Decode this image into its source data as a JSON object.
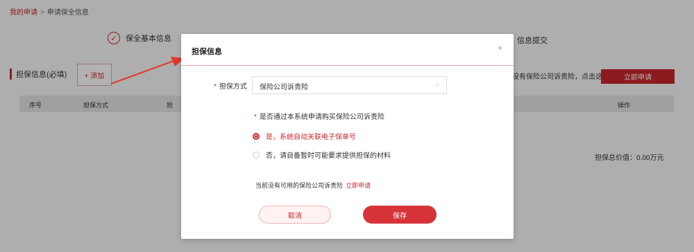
{
  "breadcrumb": {
    "home": "我的申请",
    "separator": ">",
    "current": "申请保全信息"
  },
  "steps": {
    "step1": "保全基本信息",
    "step3": "信息提交"
  },
  "section": {
    "title": "担保信息(必填)",
    "add_label": "+ 添加"
  },
  "right_tip": "没有保险公司诉责险，点击这里",
  "apply_button": "立即申请",
  "table": {
    "col_no": "序号",
    "col_method": "担保方式",
    "col_other": "担",
    "col_action": "操作"
  },
  "total": "担保总价值：0.00万元",
  "modal": {
    "title": "担保信息",
    "close": "×",
    "field_label": "担保方式",
    "select_value": "保险公司诉责险",
    "question": "是否通过本系统申请购买保险公司诉责险",
    "option_yes": "是，系统自动关联电子保单号",
    "option_no": "否，请自备暂时可能要求提供担保的材料",
    "hint_text": "当前没有可用的保险公司诉责险",
    "hint_link": "立即申请",
    "cancel_label": "取消",
    "save_label": "保存",
    "selected_option": "yes"
  },
  "colors": {
    "accent": "#c9282d"
  }
}
